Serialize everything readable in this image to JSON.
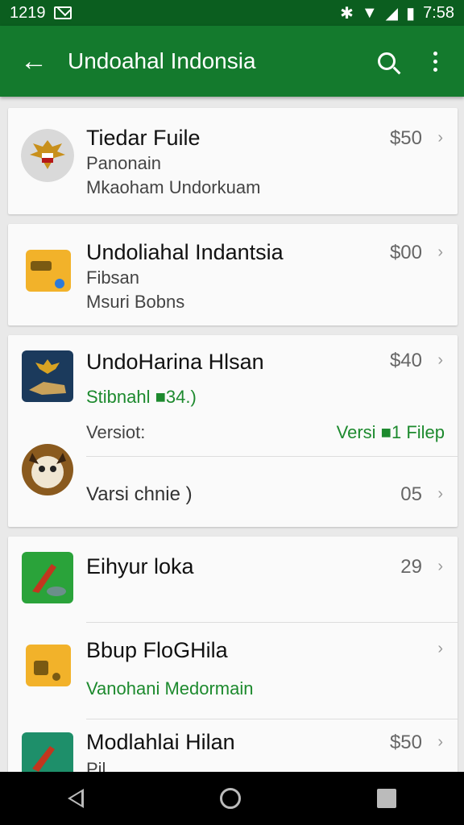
{
  "status_bar": {
    "time_left": "1219",
    "time_right": "7:58"
  },
  "app_bar": {
    "title": "Undoahal Indonsia"
  },
  "items": [
    {
      "title": "Tiedar Fuile",
      "line1": "Panonain",
      "line2": "Mkaoham Undorkuam",
      "price": "$50"
    },
    {
      "title": "Undoliahal Indantsia",
      "line1": "Fibsan",
      "line2": "Msuri Bobns",
      "price": "$00"
    },
    {
      "title": "UndoHarina Hlsan",
      "line1": "Stibnahl ■34.)",
      "price": "$40",
      "version_label": "Versiot:",
      "version_value": "Versi ■1 Filep",
      "sub_row_label": "Varsi chnie )",
      "sub_row_value": "05"
    },
    {
      "title": "Eihyur loka",
      "price": "29"
    },
    {
      "title": "Bbup FloGHila",
      "line1": "Vanohani Medormain"
    },
    {
      "title": "Modlahlai Hilan",
      "line1": "Pil...",
      "price": "$50"
    }
  ],
  "colors": {
    "primary": "#147a2d",
    "status": "#0b5e1f",
    "accent_text": "#1d8a2e"
  },
  "icons": [
    "back-arrow-icon",
    "search-icon",
    "more-vert-icon",
    "chevron-right-icon"
  ]
}
